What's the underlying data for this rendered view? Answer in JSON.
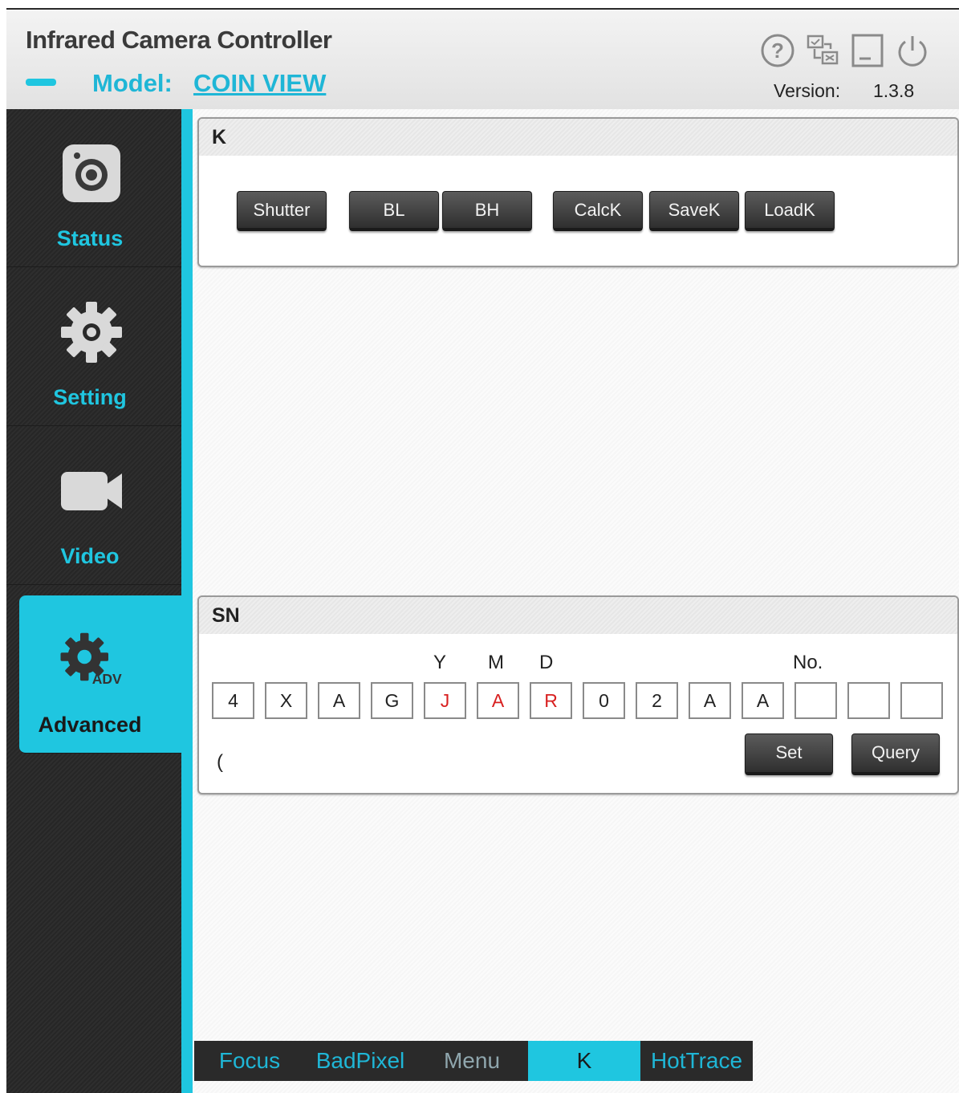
{
  "app": {
    "title": "Infrared Camera Controller",
    "model_label": "Model:",
    "model_value": "COIN VIEW",
    "version_label": "Version:",
    "version_value": "1.3.8",
    "header_icons": [
      "help-icon",
      "network-config-icon",
      "minimize-icon",
      "power-icon"
    ],
    "accent_color": "#1fc6e0"
  },
  "sidebar": {
    "items": [
      {
        "label": "Status",
        "icon": "camera-icon"
      },
      {
        "label": "Setting",
        "icon": "gear-icon"
      },
      {
        "label": "Video",
        "icon": "video-camera-icon"
      },
      {
        "label": "Advanced",
        "icon": "advanced-gear-icon",
        "icon_text": "ADV",
        "active": true
      }
    ]
  },
  "k_panel": {
    "title": "K",
    "buttons": {
      "shutter": "Shutter",
      "bl": "BL",
      "bh": "BH",
      "calck": "CalcK",
      "savek": "SaveK",
      "loadk": "LoadK"
    }
  },
  "sn_panel": {
    "title": "SN",
    "headers": {
      "y": "Y",
      "m": "M",
      "d": "D",
      "no": "No."
    },
    "chars": [
      "4",
      "X",
      "A",
      "G",
      "J",
      "A",
      "R",
      "0",
      "2",
      "A",
      "A",
      "",
      "",
      ""
    ],
    "red_indices": [
      4,
      5,
      6
    ],
    "status_text": "(",
    "set_label": "Set",
    "query_label": "Query"
  },
  "tabs": [
    {
      "label": "Focus"
    },
    {
      "label": "BadPixel"
    },
    {
      "label": "Menu"
    },
    {
      "label": "K",
      "active": true
    },
    {
      "label": "HotTrace"
    }
  ]
}
